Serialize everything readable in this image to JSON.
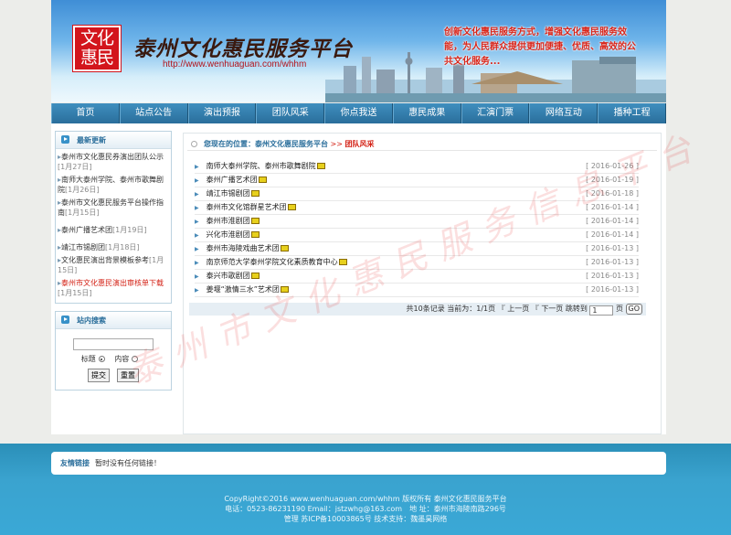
{
  "banner": {
    "logo_line1": "文化",
    "logo_line2": "惠民",
    "site_title": "泰州文化惠民服务平台",
    "url": "http://www.wenhuaguan.com/whhm",
    "slogan": "创新文化惠民服务方式，增强文化惠民服务效能，为人民群众提供更加便捷、优质、高效的公共文化服务..."
  },
  "nav": {
    "items": [
      "首页",
      "站点公告",
      "演出预报",
      "团队风采",
      "你点我送",
      "惠民成果",
      "汇演门票",
      "网络互动",
      "播种工程"
    ]
  },
  "sidebar": {
    "news_title": "最新更新",
    "news": [
      {
        "title": "泰州市文化惠民券演出团队公示",
        "date": "[1月27日]",
        "red": false
      },
      {
        "title": "南师大泰州学院、泰州市歌舞剧院",
        "date": "[1月26日]",
        "red": false
      },
      {
        "title": "泰州市文化惠民服务平台操作指南",
        "date": "[1月15日]",
        "red": false
      },
      {
        "title": "泰州广播艺术团",
        "date": "[1月19日]",
        "red": false
      },
      {
        "title": "靖江市锡剧团",
        "date": "[1月18日]",
        "red": false
      },
      {
        "title": "文化惠民演出背景模板参考",
        "date": "[1月15日]",
        "red": false
      },
      {
        "title": "泰州市文化惠民演出审核单下载",
        "date": "[1月15日]",
        "red": true
      }
    ],
    "search_title": "站内搜索",
    "search_value": "",
    "radio_title": "标题",
    "radio_content": "内容",
    "submit_label": "提交",
    "reset_label": "重置"
  },
  "breadcrumb": {
    "prefix": "您现在的位置：",
    "site": "泰州文化惠民服务平台",
    "sep": ">>",
    "current": "团队风采"
  },
  "list": [
    {
      "title": "南师大泰州学院、泰州市歌舞剧院",
      "date": "[ 2016-01-26 ]"
    },
    {
      "title": "泰州广播艺术团",
      "date": "[ 2016-01-19 ]"
    },
    {
      "title": "靖江市锡剧团",
      "date": "[ 2016-01-18 ]"
    },
    {
      "title": "泰州市文化馆群星艺术团",
      "date": "[ 2016-01-14 ]"
    },
    {
      "title": "泰州市淮剧团",
      "date": "[ 2016-01-14 ]"
    },
    {
      "title": "兴化市淮剧团",
      "date": "[ 2016-01-14 ]"
    },
    {
      "title": "泰州市海陵戏曲艺术团",
      "date": "[ 2016-01-13 ]"
    },
    {
      "title": "南京师范大学泰州学院文化素质教育中心",
      "date": "[ 2016-01-13 ]"
    },
    {
      "title": "泰兴市歌剧团",
      "date": "[ 2016-01-13 ]"
    },
    {
      "title": "姜堰“激情三水”艺术团",
      "date": "[ 2016-01-13 ]"
    }
  ],
  "pager": {
    "summary": "共10条记录 当前为：1/1页",
    "prev": "上一页",
    "next": "下一页",
    "jump": "跳转到",
    "page_value": "1",
    "page_unit": "页",
    "go": "GO"
  },
  "friend_links": {
    "label": "友情链接",
    "text": "暂时没有任何链接！"
  },
  "footer": {
    "line1": "CopyRight©2016 www.wenhuaguan.com/whhm 版权所有 泰州文化惠民服务平台",
    "line2": "电话：0523-86231190 Email：jstzwhg@163.com　地 址：泰州市海陵南路296号",
    "line3": "管理 苏ICP备10003865号 技术支持：魏墨昊网络"
  },
  "watermark": "泰州市文化惠民服务信息平台"
}
